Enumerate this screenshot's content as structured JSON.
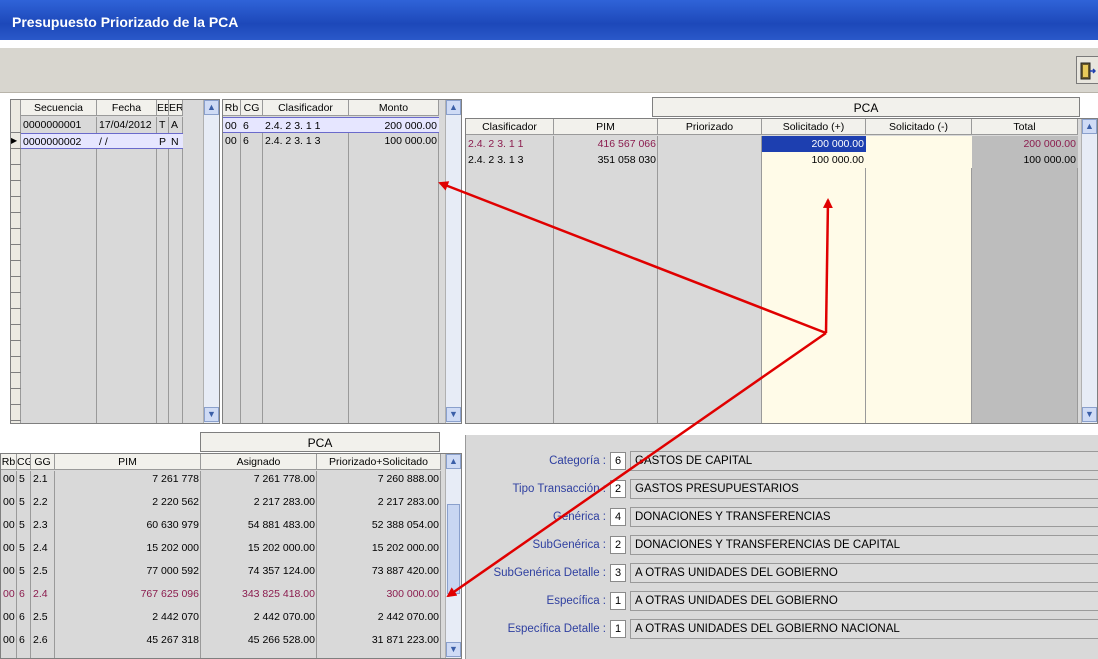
{
  "window": {
    "title": "Presupuesto Priorizado de la PCA"
  },
  "toolbar": {
    "exit_icon": "exit-door-icon"
  },
  "sequences": {
    "headers": [
      "Secuencia",
      "Fecha",
      "EE",
      "ER"
    ],
    "rows": [
      {
        "secuencia": "0000000001",
        "fecha": "17/04/2012",
        "ee": "T",
        "er": "A"
      },
      {
        "secuencia": "0000000002",
        "fecha": "/ /",
        "ee": "P",
        "er": "N"
      }
    ]
  },
  "detail": {
    "headers": [
      "Rb",
      "CG",
      "Clasificador",
      "Monto"
    ],
    "rows": [
      {
        "rb": "00",
        "cg": "6",
        "clasificador": "2.4. 2 3. 1 1",
        "monto": "200 000.00"
      },
      {
        "rb": "00",
        "cg": "6",
        "clasificador": "2.4. 2 3. 1 3",
        "monto": "100 000.00"
      }
    ]
  },
  "pca_right": {
    "band": "PCA",
    "headers": [
      "Clasificador",
      "PIM",
      "Priorizado",
      "Solicitado (+)",
      "Solicitado (-)",
      "Total"
    ],
    "rows": [
      {
        "clasificador": "2.4. 2 3. 1 1",
        "pim": "416 567 066",
        "priorizado": "",
        "sol_plus": "200 000.00",
        "sol_minus": "",
        "total": "200 000.00"
      },
      {
        "clasificador": "2.4. 2 3. 1 3",
        "pim": "351 058 030",
        "priorizado": "",
        "sol_plus": "100 000.00",
        "sol_minus": "",
        "total": "100 000.00"
      }
    ]
  },
  "summary": {
    "band": "PCA",
    "headers": [
      "Rb",
      "CG",
      "GG",
      "PIM",
      "Asignado",
      "Priorizado+Solicitado"
    ],
    "rows": [
      {
        "rb": "00",
        "cg": "5",
        "gg": "2.1",
        "pim": "7 261 778",
        "asignado": "7 261 778.00",
        "ps": "7 260 888.00"
      },
      {
        "rb": "00",
        "cg": "5",
        "gg": "2.2",
        "pim": "2 220 562",
        "asignado": "2 217 283.00",
        "ps": "2 217 283.00"
      },
      {
        "rb": "00",
        "cg": "5",
        "gg": "2.3",
        "pim": "60 630 979",
        "asignado": "54 881 483.00",
        "ps": "52 388 054.00"
      },
      {
        "rb": "00",
        "cg": "5",
        "gg": "2.4",
        "pim": "15 202 000",
        "asignado": "15 202 000.00",
        "ps": "15 202 000.00"
      },
      {
        "rb": "00",
        "cg": "5",
        "gg": "2.5",
        "pim": "77 000 592",
        "asignado": "74 357 124.00",
        "ps": "73 887 420.00"
      },
      {
        "rb": "00",
        "cg": "6",
        "gg": "2.4",
        "pim": "767 625 096",
        "asignado": "343 825 418.00",
        "ps": "300 000.00"
      },
      {
        "rb": "00",
        "cg": "6",
        "gg": "2.5",
        "pim": "2 442 070",
        "asignado": "2 442 070.00",
        "ps": "2 442 070.00"
      },
      {
        "rb": "00",
        "cg": "6",
        "gg": "2.6",
        "pim": "45 267 318",
        "asignado": "45 266 528.00",
        "ps": "31 871 223.00"
      }
    ]
  },
  "info": [
    {
      "label": "Categoría :",
      "code": "6",
      "value": "GASTOS DE CAPITAL"
    },
    {
      "label": "Tipo Transacción :",
      "code": "2",
      "value": "GASTOS PRESUPUESTARIOS"
    },
    {
      "label": "Genérica :",
      "code": "4",
      "value": "DONACIONES Y TRANSFERENCIAS"
    },
    {
      "label": "SubGenérica :",
      "code": "2",
      "value": "DONACIONES Y TRANSFERENCIAS DE CAPITAL"
    },
    {
      "label": "SubGenérica Detalle :",
      "code": "3",
      "value": "A OTRAS UNIDADES DEL GOBIERNO"
    },
    {
      "label": "Específica :",
      "code": "1",
      "value": "A OTRAS UNIDADES DEL GOBIERNO"
    },
    {
      "label": "Específica Detalle :",
      "code": "1",
      "value": "A OTRAS UNIDADES DEL GOBIERNO NACIONAL"
    }
  ],
  "colors": {
    "title_bar": "#2157d0",
    "highlight_text": "#8b1c4e",
    "arrow": "#e00000"
  }
}
